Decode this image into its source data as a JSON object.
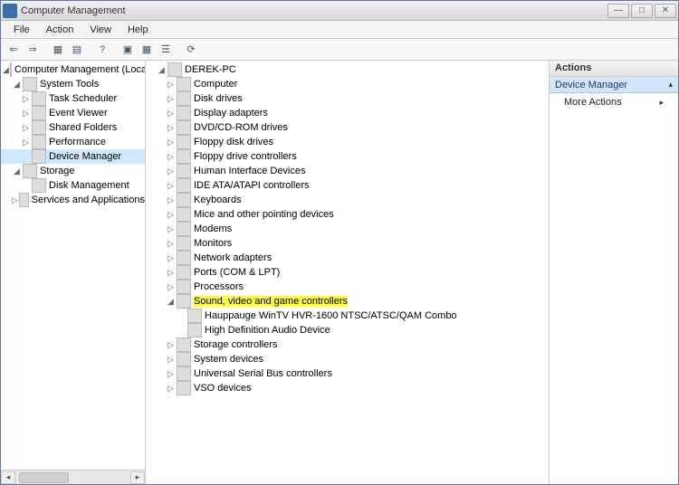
{
  "window": {
    "title": "Computer Management"
  },
  "menu": {
    "file": "File",
    "action": "Action",
    "view": "View",
    "help": "Help"
  },
  "left_tree": {
    "root": "Computer Management (Local",
    "system_tools": "System Tools",
    "task_scheduler": "Task Scheduler",
    "event_viewer": "Event Viewer",
    "shared_folders": "Shared Folders",
    "performance": "Performance",
    "device_manager": "Device Manager",
    "storage": "Storage",
    "disk_management": "Disk Management",
    "services_apps": "Services and Applications"
  },
  "center_tree": {
    "root": "DEREK-PC",
    "computer": "Computer",
    "disk_drives": "Disk drives",
    "display_adapters": "Display adapters",
    "dvd_cd": "DVD/CD-ROM drives",
    "floppy_drives": "Floppy disk drives",
    "floppy_ctrl": "Floppy drive controllers",
    "hid": "Human Interface Devices",
    "ide": "IDE ATA/ATAPI controllers",
    "keyboards": "Keyboards",
    "mice": "Mice and other pointing devices",
    "modems": "Modems",
    "monitors": "Monitors",
    "network": "Network adapters",
    "ports": "Ports (COM & LPT)",
    "processors": "Processors",
    "sound": "Sound, video and game controllers",
    "sound_child1": "Hauppauge WinTV HVR-1600 NTSC/ATSC/QAM Combo",
    "sound_child2": "High Definition Audio Device",
    "storage_ctrl": "Storage controllers",
    "system_devices": "System devices",
    "usb": "Universal Serial Bus controllers",
    "vso": "VSO devices"
  },
  "actions": {
    "header": "Actions",
    "section": "Device Manager",
    "more": "More Actions"
  }
}
